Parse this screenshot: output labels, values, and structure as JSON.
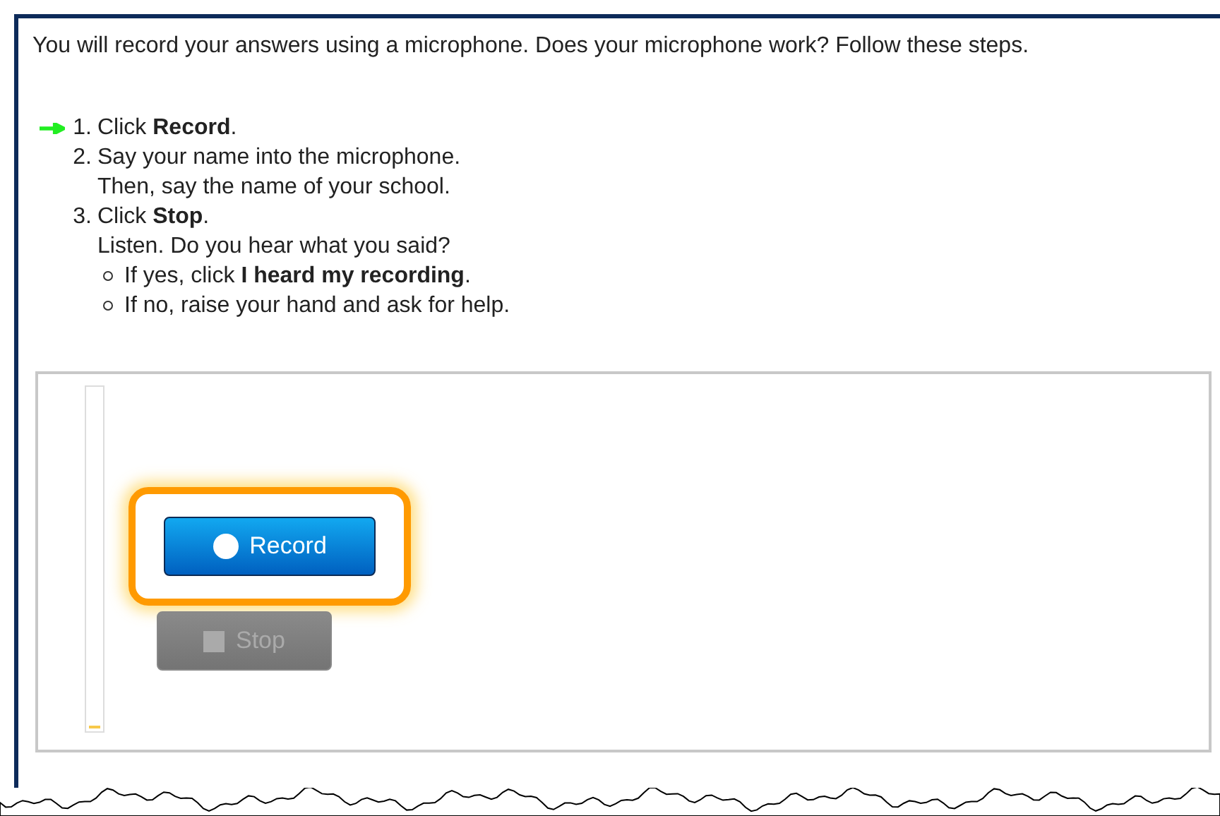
{
  "intro": "You will record your answers using a microphone. Does your microphone work? Follow these steps.",
  "steps": [
    {
      "number": "1.",
      "text": "Click **Record**.",
      "current": true
    },
    {
      "number": "2.",
      "text": "Say your name into the microphone.",
      "lines": [
        "Then, say the name of your school."
      ],
      "current": false
    },
    {
      "number": "3.",
      "text": "Click **Stop**.",
      "lines": [
        "Listen. Do you hear what you said?"
      ],
      "bullets": [
        "If yes, click **I heard my recording**.",
        "If no, raise your hand and ask for help."
      ],
      "current": false
    }
  ],
  "recorder": {
    "meter": {
      "level": 0.01
    },
    "record_button": {
      "label": "Record",
      "highlighted": true,
      "disabled": false
    },
    "stop_button": {
      "label": "Stop",
      "highlighted": false,
      "disabled": true
    }
  }
}
